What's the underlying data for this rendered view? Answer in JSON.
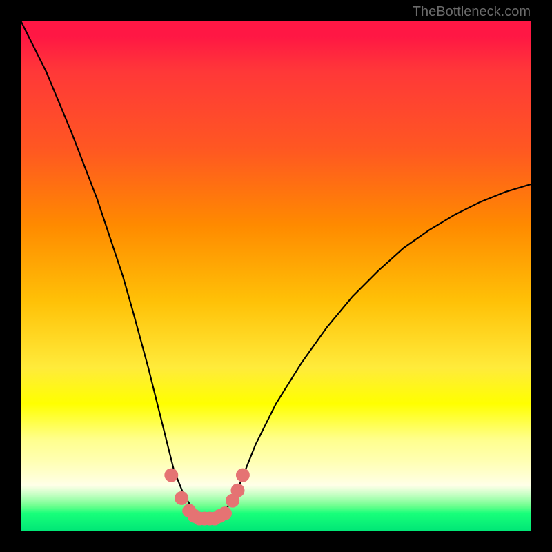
{
  "watermark": "TheBottleneck.com",
  "chart_data": {
    "type": "line",
    "title": "",
    "xlabel": "",
    "ylabel": "",
    "xlim": [
      0,
      100
    ],
    "ylim": [
      0,
      100
    ],
    "series": [
      {
        "name": "bottleneck-curve",
        "x": [
          0,
          5,
          10,
          15,
          20,
          22,
          25,
          28,
          30,
          32,
          34,
          35,
          36,
          37,
          38,
          39,
          40,
          42,
          44,
          46,
          50,
          55,
          60,
          65,
          70,
          75,
          80,
          85,
          90,
          95,
          100
        ],
        "y": [
          100,
          90,
          78,
          65,
          50,
          43,
          32,
          20,
          12,
          7,
          4,
          3,
          2.5,
          2.5,
          2.5,
          3,
          4,
          7,
          12,
          17,
          25,
          33,
          40,
          46,
          51,
          55.5,
          59,
          62,
          64.5,
          66.5,
          68
        ]
      }
    ],
    "markers": [
      {
        "x": 29.5,
        "y": 11
      },
      {
        "x": 31.5,
        "y": 6.5
      },
      {
        "x": 33,
        "y": 4
      },
      {
        "x": 34,
        "y": 3
      },
      {
        "x": 35,
        "y": 2.5
      },
      {
        "x": 36,
        "y": 2.5
      },
      {
        "x": 37,
        "y": 2.5
      },
      {
        "x": 38,
        "y": 2.5
      },
      {
        "x": 39,
        "y": 3
      },
      {
        "x": 40,
        "y": 3.5
      },
      {
        "x": 41.5,
        "y": 6
      },
      {
        "x": 42.5,
        "y": 8
      },
      {
        "x": 43.5,
        "y": 11
      }
    ],
    "colors": {
      "curve": "#000000",
      "marker": "#E57373"
    }
  }
}
